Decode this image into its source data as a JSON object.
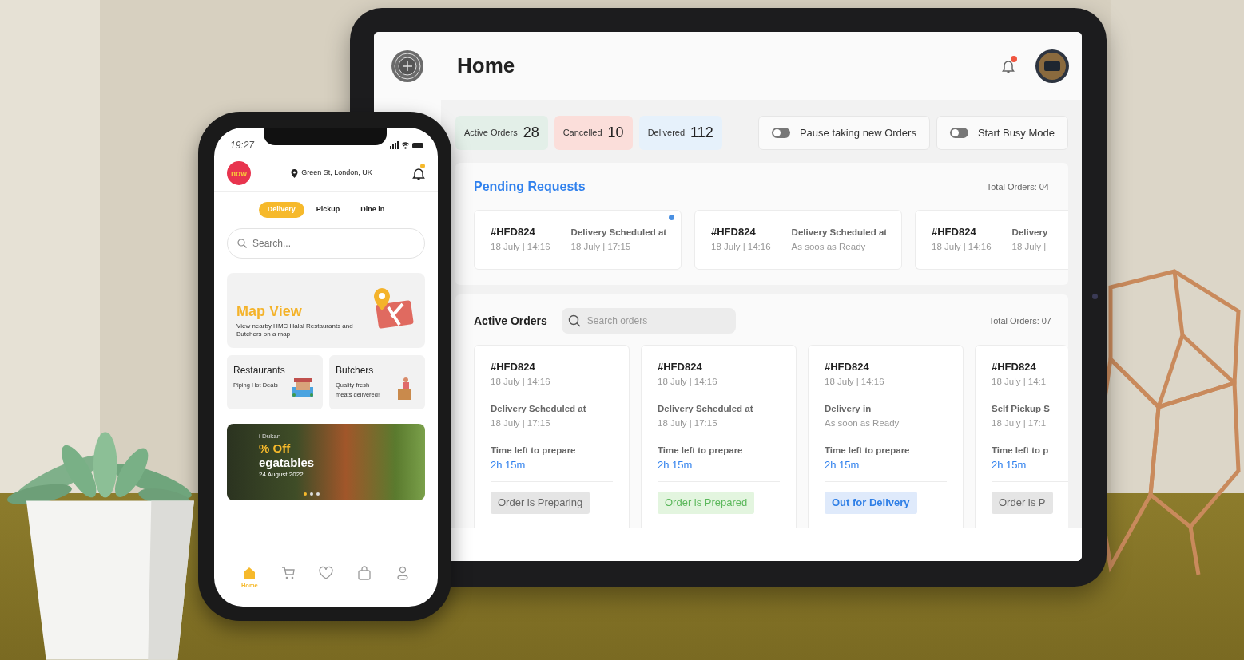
{
  "phone": {
    "status_time": "19:27",
    "logo_text": "now",
    "location": "Green St, London, UK",
    "notification_unread": true,
    "tabs": [
      {
        "label": "Delivery",
        "selected": true
      },
      {
        "label": "Pickup",
        "selected": false
      },
      {
        "label": "Dine in",
        "selected": false
      }
    ],
    "search": {
      "placeholder": "Search..."
    },
    "map_card": {
      "title": "Map View",
      "description": "View nearby HMC Halal Restaurants and Butchers on a map"
    },
    "categories": [
      {
        "kind": "restaurant",
        "title": "Restaurants",
        "subtitle": "Piping Hot Deals"
      },
      {
        "kind": "butcher",
        "title": "Butchers",
        "subtitle": "Quality fresh meats delivered!"
      }
    ],
    "banner": {
      "store": "i Dukan",
      "headline": "% Off",
      "subhead": "egatables",
      "date": "24 August 2022",
      "slides": [
        {
          "selected": true
        },
        {
          "selected": false
        },
        {
          "selected": false
        }
      ]
    },
    "bottom_nav": [
      {
        "kind": "home",
        "label": "Home",
        "selected": true
      },
      {
        "kind": "cart",
        "selected": false
      },
      {
        "kind": "heart",
        "selected": false
      },
      {
        "kind": "bag",
        "selected": false
      },
      {
        "kind": "user",
        "selected": false
      }
    ]
  },
  "tablet": {
    "title": "Home",
    "notification_unread": true,
    "stats": [
      {
        "label": "Active Orders",
        "value": "28",
        "color": "#e3efe8"
      },
      {
        "label": "Cancelled",
        "value": "10",
        "color": "#fbdeda"
      },
      {
        "label": "Delivered",
        "value": "112",
        "color": "#e6f1fb"
      }
    ],
    "toggles": [
      {
        "label": "Pause taking new Orders",
        "on": false
      },
      {
        "label": "Start Busy Mode",
        "on": false
      }
    ],
    "pending": {
      "title": "Pending Requests",
      "total": "Total Orders: 04",
      "requests": [
        {
          "id": "#HFD824",
          "placed": "18 July | 14:16",
          "schedule_label": "Delivery Scheduled at",
          "schedule_value": "18 July | 17:15",
          "unread": true
        },
        {
          "id": "#HFD824",
          "placed": "18 July | 14:16",
          "schedule_label": "Delivery Scheduled at",
          "schedule_value": "As soos as Ready",
          "unread": false
        },
        {
          "id": "#HFD824",
          "placed": "18 July | 14:16",
          "schedule_label": "Delivery",
          "schedule_value": "18 July |",
          "unread": false
        }
      ]
    },
    "active": {
      "title": "Active Orders",
      "search": {
        "placeholder": "Search orders"
      },
      "total": "Total Orders: 07",
      "orders": [
        {
          "id": "#HFD824",
          "placed": "18 July | 14:16",
          "schedule_label": "Delivery Scheduled at",
          "schedule_value": "18 July | 17:15",
          "time_label": "Time left to prepare",
          "time_left": "2h 15m",
          "status": "Order is Preparing",
          "kind": "preparing"
        },
        {
          "id": "#HFD824",
          "placed": "18 July | 14:16",
          "schedule_label": "Delivery Scheduled at",
          "schedule_value": "18 July | 17:15",
          "time_label": "Time left to prepare",
          "time_left": "2h 15m",
          "status": "Order is Prepared",
          "kind": "prepared"
        },
        {
          "id": "#HFD824",
          "placed": "18 July | 14:16",
          "schedule_label": "Delivery in",
          "schedule_value": "As soon as Ready",
          "time_label": "Time left to prepare",
          "time_left": "2h 15m",
          "status": "Out for Delivery",
          "kind": "out_for_delivery"
        },
        {
          "id": "#HFD824",
          "placed": "18 July | 14:1",
          "schedule_label": "Self Pickup S",
          "schedule_value": "18 July | 17:1",
          "time_label": "Time left to p",
          "time_left": "2h 15m",
          "status": "Order is P",
          "kind": "preparing"
        }
      ]
    }
  }
}
